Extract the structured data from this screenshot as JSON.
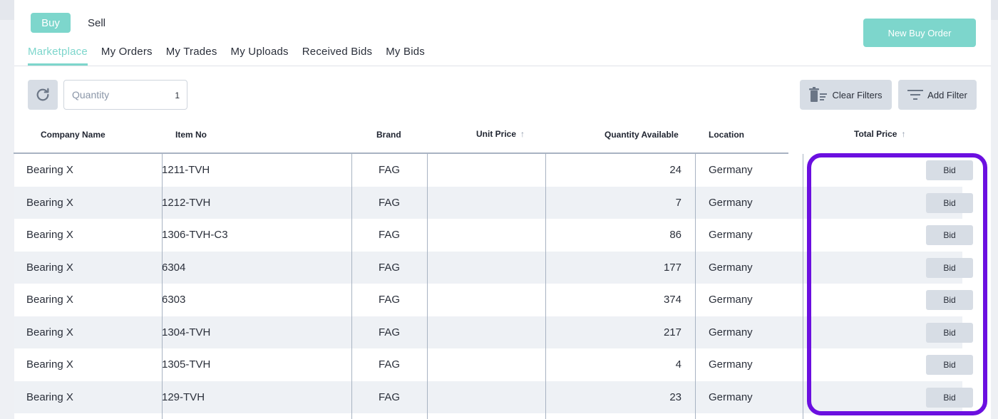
{
  "mode_toggle": {
    "buy_label": "Buy",
    "sell_label": "Sell"
  },
  "new_order_label": "New Buy Order",
  "tabs": [
    {
      "label": "Marketplace",
      "active": true
    },
    {
      "label": "My Orders"
    },
    {
      "label": "My Trades"
    },
    {
      "label": "My Uploads"
    },
    {
      "label": "Received Bids"
    },
    {
      "label": "My Bids"
    }
  ],
  "filters": {
    "quantity_label": "Quantity",
    "quantity_value": "1",
    "clear_label": "Clear Filters",
    "add_label": "Add Filter"
  },
  "table": {
    "columns": {
      "company": "Company Name",
      "item": "Item No",
      "brand": "Brand",
      "unit_price": "Unit Price",
      "quantity": "Quantity Available",
      "location": "Location",
      "total_price": "Total Price"
    },
    "bid_label": "Bid",
    "rows": [
      {
        "company": "Bearing X",
        "item": "1211-TVH",
        "brand": "FAG",
        "quantity": "24",
        "location": "Germany"
      },
      {
        "company": "Bearing X",
        "item": "1212-TVH",
        "brand": "FAG",
        "quantity": "7",
        "location": "Germany"
      },
      {
        "company": "Bearing X",
        "item": "1306-TVH-C3",
        "brand": "FAG",
        "quantity": "86",
        "location": "Germany"
      },
      {
        "company": "Bearing X",
        "item": "6304",
        "brand": "FAG",
        "quantity": "177",
        "location": "Germany"
      },
      {
        "company": "Bearing X",
        "item": "6303",
        "brand": "FAG",
        "quantity": "374",
        "location": "Germany"
      },
      {
        "company": "Bearing X",
        "item": "1304-TVH",
        "brand": "FAG",
        "quantity": "217",
        "location": "Germany"
      },
      {
        "company": "Bearing X",
        "item": "1305-TVH",
        "brand": "FAG",
        "quantity": "4",
        "location": "Germany"
      },
      {
        "company": "Bearing X",
        "item": "129-TVH",
        "brand": "FAG",
        "quantity": "23",
        "location": "Germany"
      }
    ]
  },
  "colors": {
    "accent": "#7dd6cc",
    "button_gray": "#d7dde5",
    "highlight": "#6b0fe0"
  }
}
